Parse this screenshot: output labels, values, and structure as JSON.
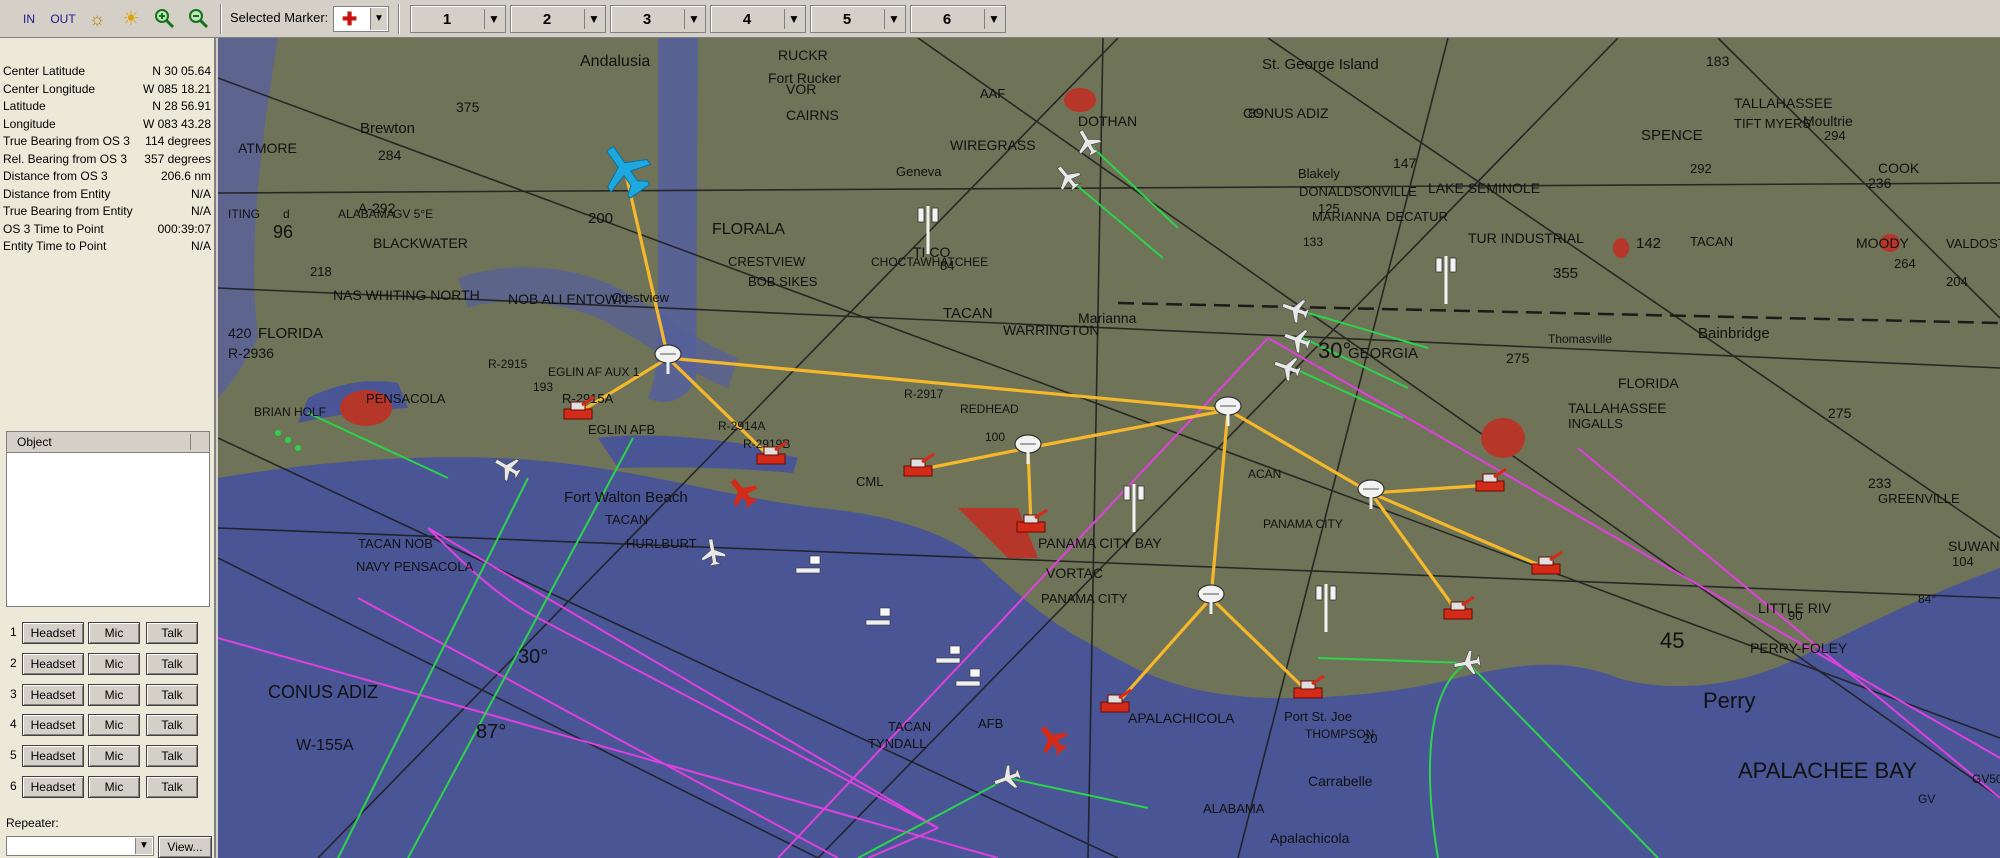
{
  "toolbar": {
    "in_label": "IN",
    "out_label": "OUT",
    "selected_marker_label": "Selected Marker:",
    "tabs": [
      "1",
      "2",
      "3",
      "4",
      "5",
      "6"
    ]
  },
  "info": [
    {
      "label": "Center Latitude",
      "value": "N 30 05.64"
    },
    {
      "label": "Center Longitude",
      "value": "W 085 18.21"
    },
    {
      "label": "Latitude",
      "value": "N 28 56.91"
    },
    {
      "label": "Longitude",
      "value": "W 083 43.28"
    },
    {
      "label": "True Bearing from OS 3",
      "value": "114 degrees"
    },
    {
      "label": "Rel. Bearing from OS 3",
      "value": "357 degrees"
    },
    {
      "label": "Distance from OS 3",
      "value": "206.6 nm"
    },
    {
      "label": "Distance from Entity",
      "value": "N/A"
    },
    {
      "label": "True Bearing from Entity",
      "value": "N/A"
    },
    {
      "label": "OS 3 Time to Point",
      "value": "000:39:07"
    },
    {
      "label": "Entity Time to Point",
      "value": "N/A"
    }
  ],
  "object_panel": {
    "header": "Object"
  },
  "comms": {
    "rows": [
      "1",
      "2",
      "3",
      "4",
      "5",
      "6"
    ],
    "headset_label": "Headset",
    "mic_label": "Mic",
    "talk_label": "Talk"
  },
  "repeater": {
    "label": "Repeater:",
    "view_label": "View..."
  },
  "colors": {
    "land": "#6f7358",
    "water": "#4a5595",
    "link": "#f5b82a",
    "track": "#2bd44a",
    "boundary": "#e040e0",
    "hostile": "#d42a18",
    "friendly_air": "#1ea8e0"
  },
  "map_labels": [
    "Andalusia",
    "375",
    "RUCKR",
    "Fort Rucker",
    "VOR",
    "CAIRNS",
    "AAF",
    "DOTHAN",
    "WIREGRASS",
    "Geneva",
    "Brewton",
    "ATMORE",
    "284",
    "96",
    "A-292",
    "BLACKWATER",
    "200",
    "FLORALA",
    "CRESTVIEW",
    "BOB SIKES",
    "218",
    "NAS WHITING NORTH",
    "NOB ALLENTOWN",
    "Crestview",
    "R-2915",
    "EGLIN AF AUX 1",
    "193",
    "R-2915A",
    "BRIAN HOLF",
    "PENSACOLA",
    "EGLIN AFB",
    "R-2914A",
    "R-2919B",
    "Fort Walton Beach",
    "TACAN",
    "HURLBURT",
    "TACAN NOB",
    "NAVY PENSACOLA",
    "30°",
    "87°",
    "CONUS ADIZ",
    "W-155A",
    "TACAN",
    "TYNDALL",
    "CHOCTAWHATCHEE",
    "TI CO",
    "84",
    "TACAN",
    "WARRINGTON",
    "Marianna",
    "R-2917",
    "REDHEAD",
    "100",
    "CML",
    "PANAMA CITY BAY",
    "VORTAC",
    "PANAMA CITY",
    "AFB",
    "PANAMA CITY",
    "APALACHICOLA",
    "Port St. Joe",
    "THOMPSON",
    "20",
    "Carrabelle",
    "Apalachicola",
    "St. George Island",
    "CONUS ADIZ",
    "Blakely",
    "125",
    "DONALDSONVILLE",
    "MARIANNA",
    "133",
    "147",
    "LAKE SEMINOLE",
    "DECATUR",
    "TUR INDUSTRIAL",
    "142",
    "355",
    "Bainbridge",
    "Thomasville",
    "GEORGIA",
    "FLORIDA",
    "275",
    "TALLAHASSEE",
    "INGALLS",
    "183",
    "TALLAHASSEE",
    "TIFT MYERS",
    "SPENCE",
    "292",
    "Moultrie",
    "294",
    "COOK",
    "236",
    "TACAN",
    "MOODY",
    "264",
    "VALDOSTA",
    "204",
    "275",
    "233",
    "GREENVILLE",
    "SUWANNEE",
    "104",
    "LITTLE RIV",
    "90",
    "PERRY-FOLEY",
    "45",
    "Perry",
    "APALACHEE BAY",
    "30°",
    "84°",
    "GV50°E",
    "GV",
    "89",
    "420",
    "R-2936",
    "ALABAMA",
    "FLORIDA",
    "ACAN",
    "ITING",
    "d",
    "ALABAMA",
    "GV 5°E"
  ]
}
